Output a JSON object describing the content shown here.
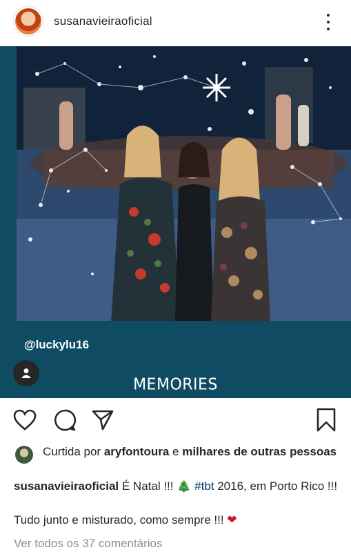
{
  "header": {
    "username": "susanavieiraoficial",
    "avatar_icon": "profile-avatar",
    "more_icon": "more-options-icon"
  },
  "post": {
    "tag_username": "@luckylu16",
    "overlay_text": "MEMORIES",
    "tag_icon": "person-icon"
  },
  "actions": {
    "like_icon": "heart-icon",
    "comment_icon": "comment-icon",
    "share_icon": "send-icon",
    "save_icon": "bookmark-icon"
  },
  "likes": {
    "prefix": "Curtida por ",
    "liker": "aryfontoura",
    "joiner": " e ",
    "others": "milhares de outras pessoas"
  },
  "caption": {
    "author": "susanavieiraoficial",
    "text_a": " É Natal !!! ",
    "tree_emoji": "🎄",
    "hashtag": "#tbt",
    "text_b": " 2016, em Porto Rico !!!",
    "line2": "Tudo junto e misturado, como sempre !!! ",
    "heart_emoji": "❤"
  },
  "comments": {
    "view_all": "Ver todos os 37 comentários"
  },
  "colors": {
    "post_border": "#0f4c64",
    "text": "#262626",
    "muted": "#8e8e8e",
    "hashtag": "#003569"
  }
}
